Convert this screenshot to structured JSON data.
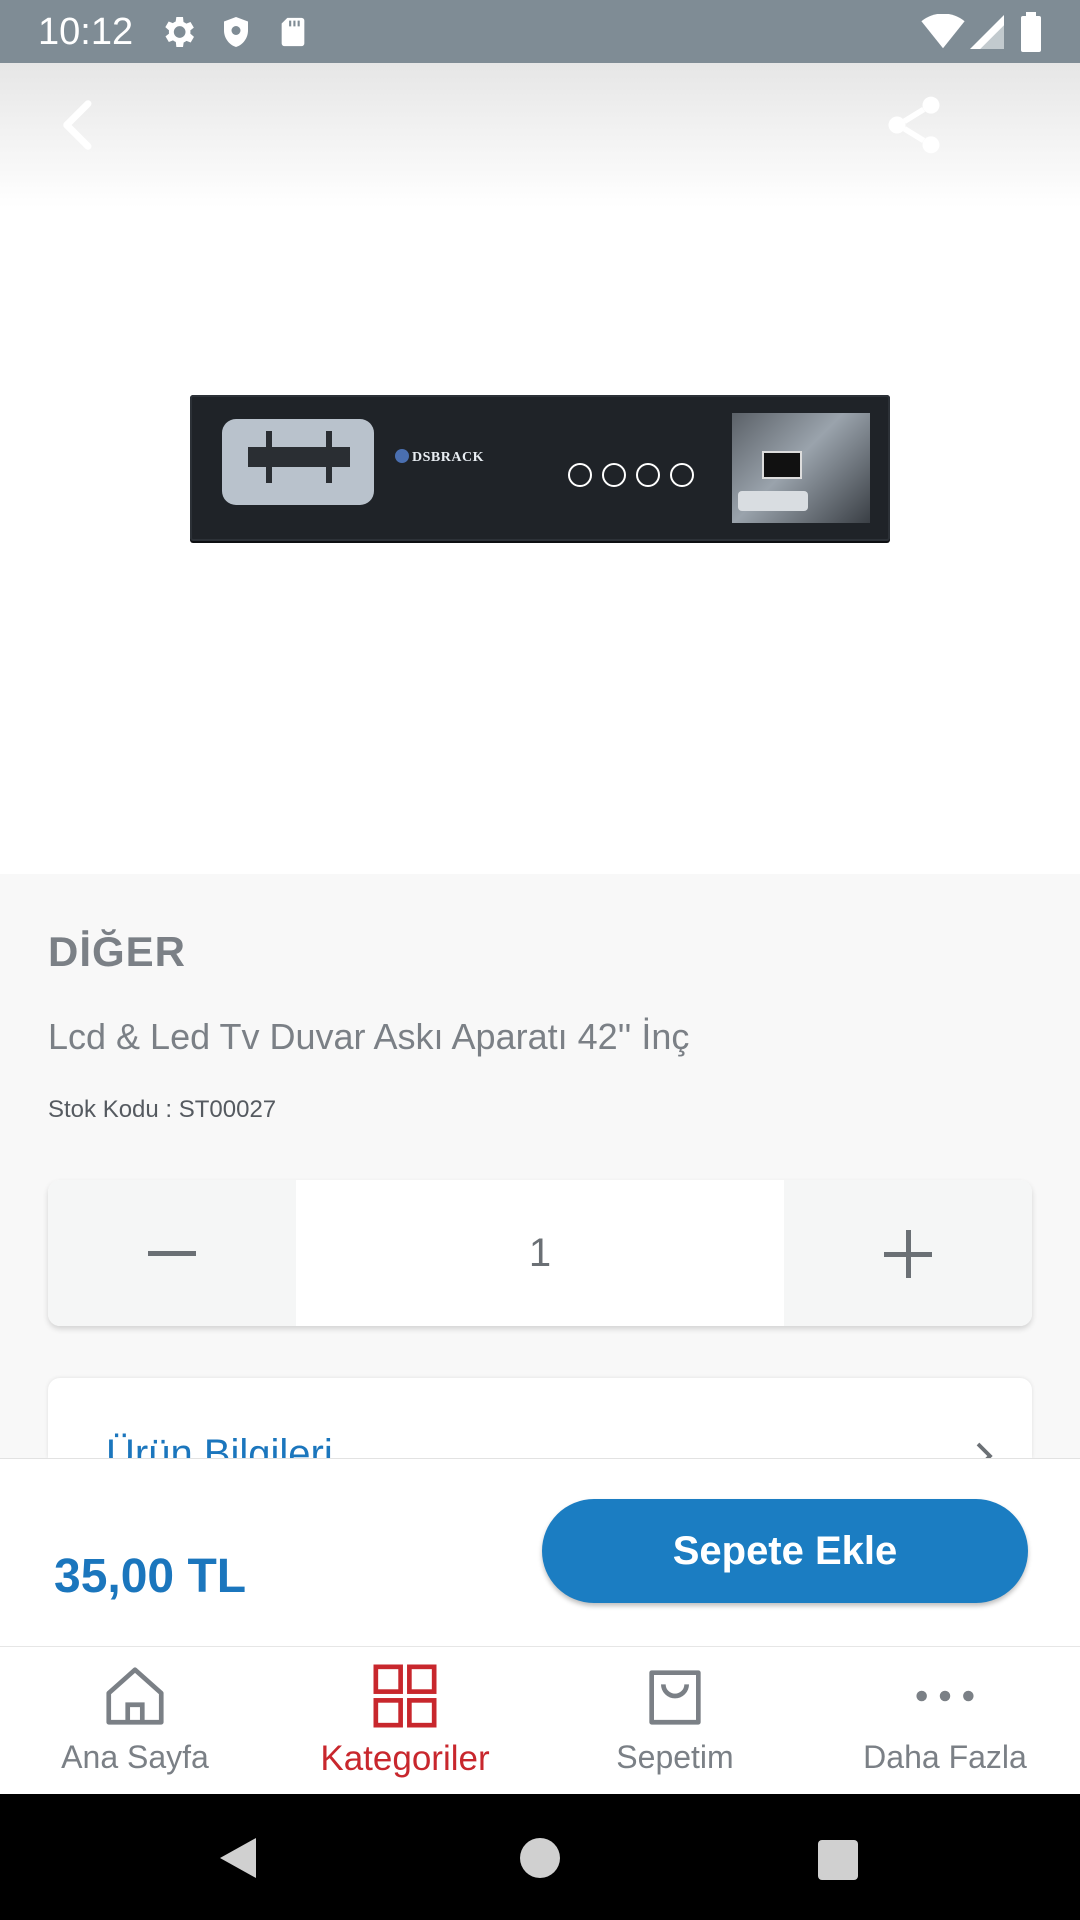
{
  "status_bar": {
    "time": "10:12"
  },
  "product": {
    "brand": "DİĞER",
    "name": "Lcd & Led Tv Duvar Askı Aparatı 42'' İnç",
    "stock_code": "Stok Kodu : ST00027",
    "image_alt": "DSBRACK",
    "quantity": "1"
  },
  "sections": {
    "product_info_label": "Ürün Bilgileri"
  },
  "buy_bar": {
    "price": "35,00 TL",
    "add_to_cart_label": "Sepete Ekle"
  },
  "bottom_nav": {
    "items": [
      {
        "label": "Ana Sayfa",
        "icon": "home-icon"
      },
      {
        "label": "Kategoriler",
        "icon": "grid-icon",
        "active": true
      },
      {
        "label": "Sepetim",
        "icon": "shopping-bag-icon"
      },
      {
        "label": "Daha Fazla",
        "icon": "more-dots-icon"
      }
    ]
  },
  "colors": {
    "accent": "#1b7dc2",
    "active_nav": "#c8272d",
    "status_bar": "#7f8c95"
  }
}
